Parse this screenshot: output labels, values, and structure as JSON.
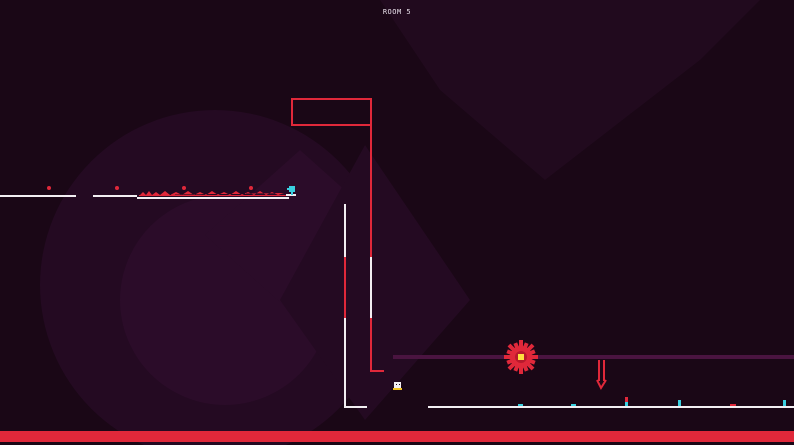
{
  "hud": {
    "room_label": "ROOM 5"
  },
  "colors": {
    "background": "#1a0716",
    "bg_shape_dark": "#220a1f",
    "bg_shape_light": "#2c0c2a",
    "wall_white": "#f2eef2",
    "hazard_red": "#e0283a",
    "laser_track": "#4a1440",
    "player_body": "#f2eef2",
    "player_feet": "#f0c020",
    "accent_cyan": "#3ad0e0",
    "saw_core": "#ffe040"
  },
  "entities": {
    "player": "player-character",
    "checkpoint": "checkpoint-flag",
    "saw": "spinning-saw-blade",
    "arrow": "downward-arrow-spike"
  }
}
